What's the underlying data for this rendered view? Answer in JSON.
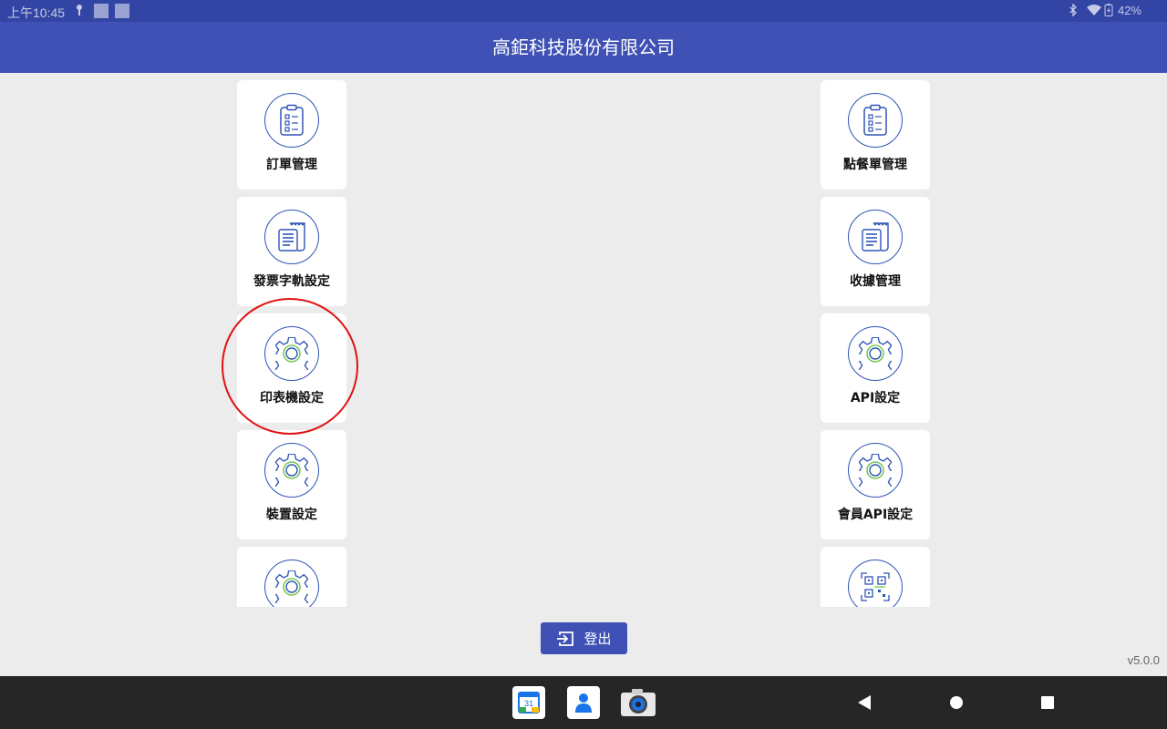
{
  "status": {
    "time": "上午10:45",
    "battery": "42%"
  },
  "header": {
    "title": "高鉅科技股份有限公司"
  },
  "menu": {
    "left": [
      {
        "label": "訂單管理",
        "icon": "clipboard-icon"
      },
      {
        "label": "發票字軌設定",
        "icon": "receipt-icon"
      },
      {
        "label": "印表機設定",
        "icon": "gear-icon"
      },
      {
        "label": "裝置設定",
        "icon": "gear-icon"
      },
      {
        "label": "",
        "icon": "gear-icon"
      }
    ],
    "right": [
      {
        "label": "點餐單管理",
        "icon": "clipboard-icon"
      },
      {
        "label": "收據管理",
        "icon": "receipt-icon"
      },
      {
        "label": "API設定",
        "icon": "gear-icon"
      },
      {
        "label": "會員API設定",
        "icon": "gear-icon"
      },
      {
        "label": "",
        "icon": "qrcode-icon"
      }
    ]
  },
  "logout": {
    "label": "登出"
  },
  "version": "v5.0.0",
  "dock": {
    "calendar_day": "31"
  },
  "colors": {
    "appbar": "#3f51b5",
    "statusbar": "#3345a4",
    "highlight": "#e01010",
    "icon_stroke": "#2e55b5",
    "gear_accent": "#7bc85a"
  }
}
